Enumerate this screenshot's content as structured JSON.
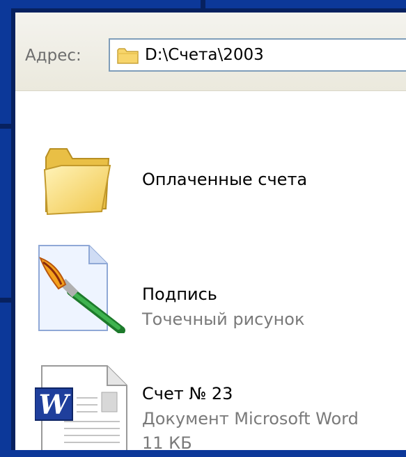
{
  "address": {
    "label": "Адрес:",
    "path": "D:\\Счета\\2003"
  },
  "items": [
    {
      "name": "Оплаченные счета",
      "icon": "folder-icon"
    },
    {
      "name": "Подпись",
      "type": "Точечный рисунок",
      "icon": "bitmap-file-icon"
    },
    {
      "name": "Счет № 23",
      "type": "Документ Microsoft Word",
      "size": "11 КБ",
      "icon": "word-document-icon"
    }
  ],
  "colors": {
    "frame": "#0c3899",
    "folder": "#f7d56b",
    "address_border": "#7f9db9",
    "secondary_text": "#7a7a7a"
  }
}
